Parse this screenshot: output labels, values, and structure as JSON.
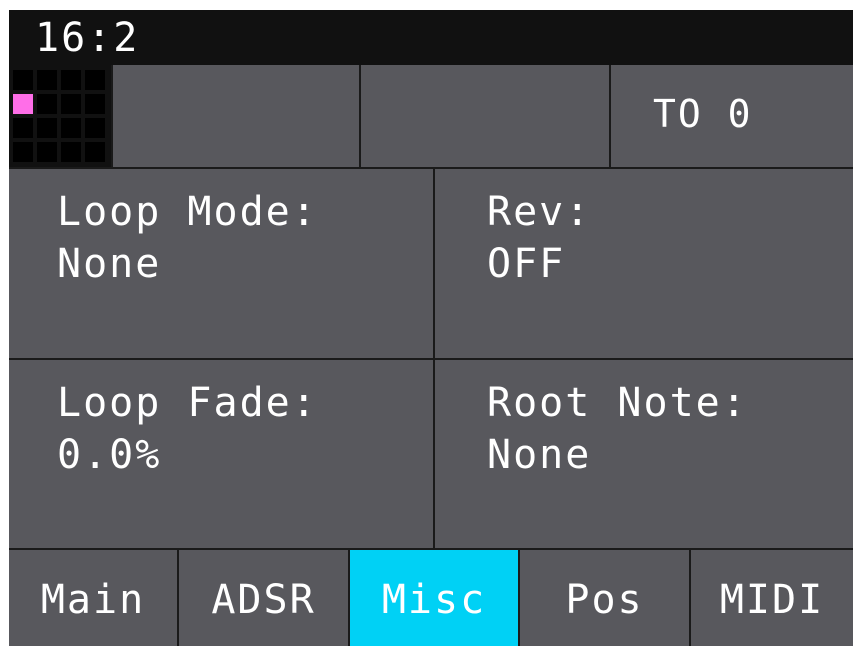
{
  "status": {
    "clock": "16:2"
  },
  "topbar": {
    "grid_icon": {
      "rows": 4,
      "cols": 4,
      "active_cell": "row 2, col 1",
      "active_color": "#ff6ee8"
    },
    "cells": [
      "",
      "",
      "TO 0"
    ]
  },
  "params": [
    {
      "name": "Loop Mode:",
      "value": "None"
    },
    {
      "name": "Rev:",
      "value": "OFF"
    },
    {
      "name": "Loop Fade:",
      "value": "0.0%"
    },
    {
      "name": "Root Note:",
      "value": "None"
    }
  ],
  "tabs": [
    {
      "label": "Main"
    },
    {
      "label": "ADSR"
    },
    {
      "label": "Misc"
    },
    {
      "label": "Pos"
    },
    {
      "label": "MIDI"
    }
  ],
  "selected_tab": "Misc",
  "colors": {
    "background": "#58585d",
    "statusbar": "#111111",
    "selected_tab": "#00d1f5",
    "text": "#ffffff"
  }
}
